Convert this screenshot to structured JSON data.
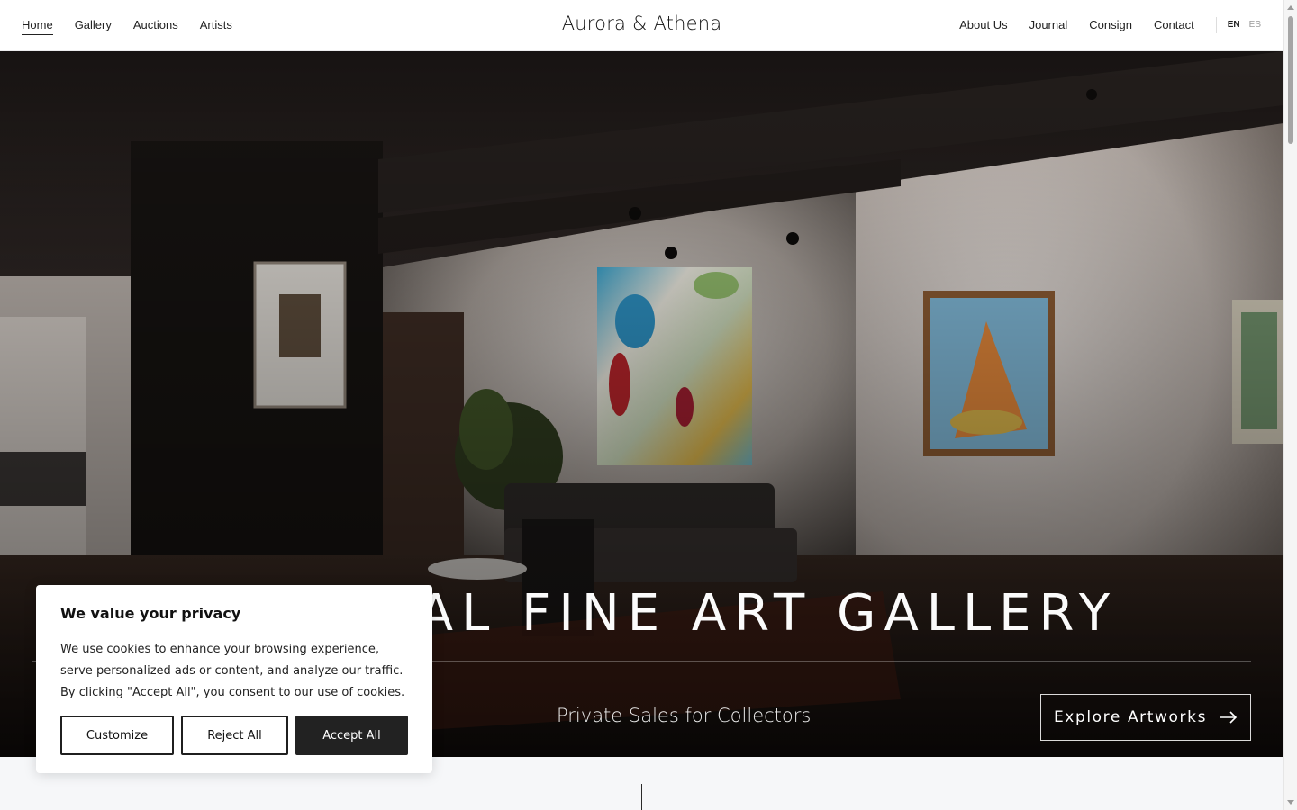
{
  "header": {
    "brand": "Aurora & Athena",
    "nav_left": [
      {
        "label": "Home",
        "active": true
      },
      {
        "label": "Gallery"
      },
      {
        "label": "Auctions"
      },
      {
        "label": "Artists"
      }
    ],
    "nav_right": [
      {
        "label": "About Us"
      },
      {
        "label": "Journal"
      },
      {
        "label": "Consign"
      },
      {
        "label": "Contact"
      }
    ],
    "languages": {
      "current": "EN",
      "other": "ES"
    }
  },
  "hero": {
    "title": "INTERNATIONAL FINE ART GALLERY",
    "visible_title": "NAL FINE ART GALLERY",
    "subtitle": "Private Sales for Collectors",
    "cta_label": "Explore Artworks",
    "cta_icon": "arrow-right-icon"
  },
  "cookie_banner": {
    "title": "We value your privacy",
    "body": "We use cookies to enhance your browsing experience, serve personalized ads or content, and analyze our traffic. By clicking \"Accept All\", you consent to our use of cookies.",
    "buttons": {
      "customize": "Customize",
      "reject": "Reject All",
      "accept": "Accept All"
    }
  },
  "colors": {
    "accent_dark": "#222222",
    "header_bg": "#ffffff",
    "page_bg": "#f6f7f9"
  }
}
